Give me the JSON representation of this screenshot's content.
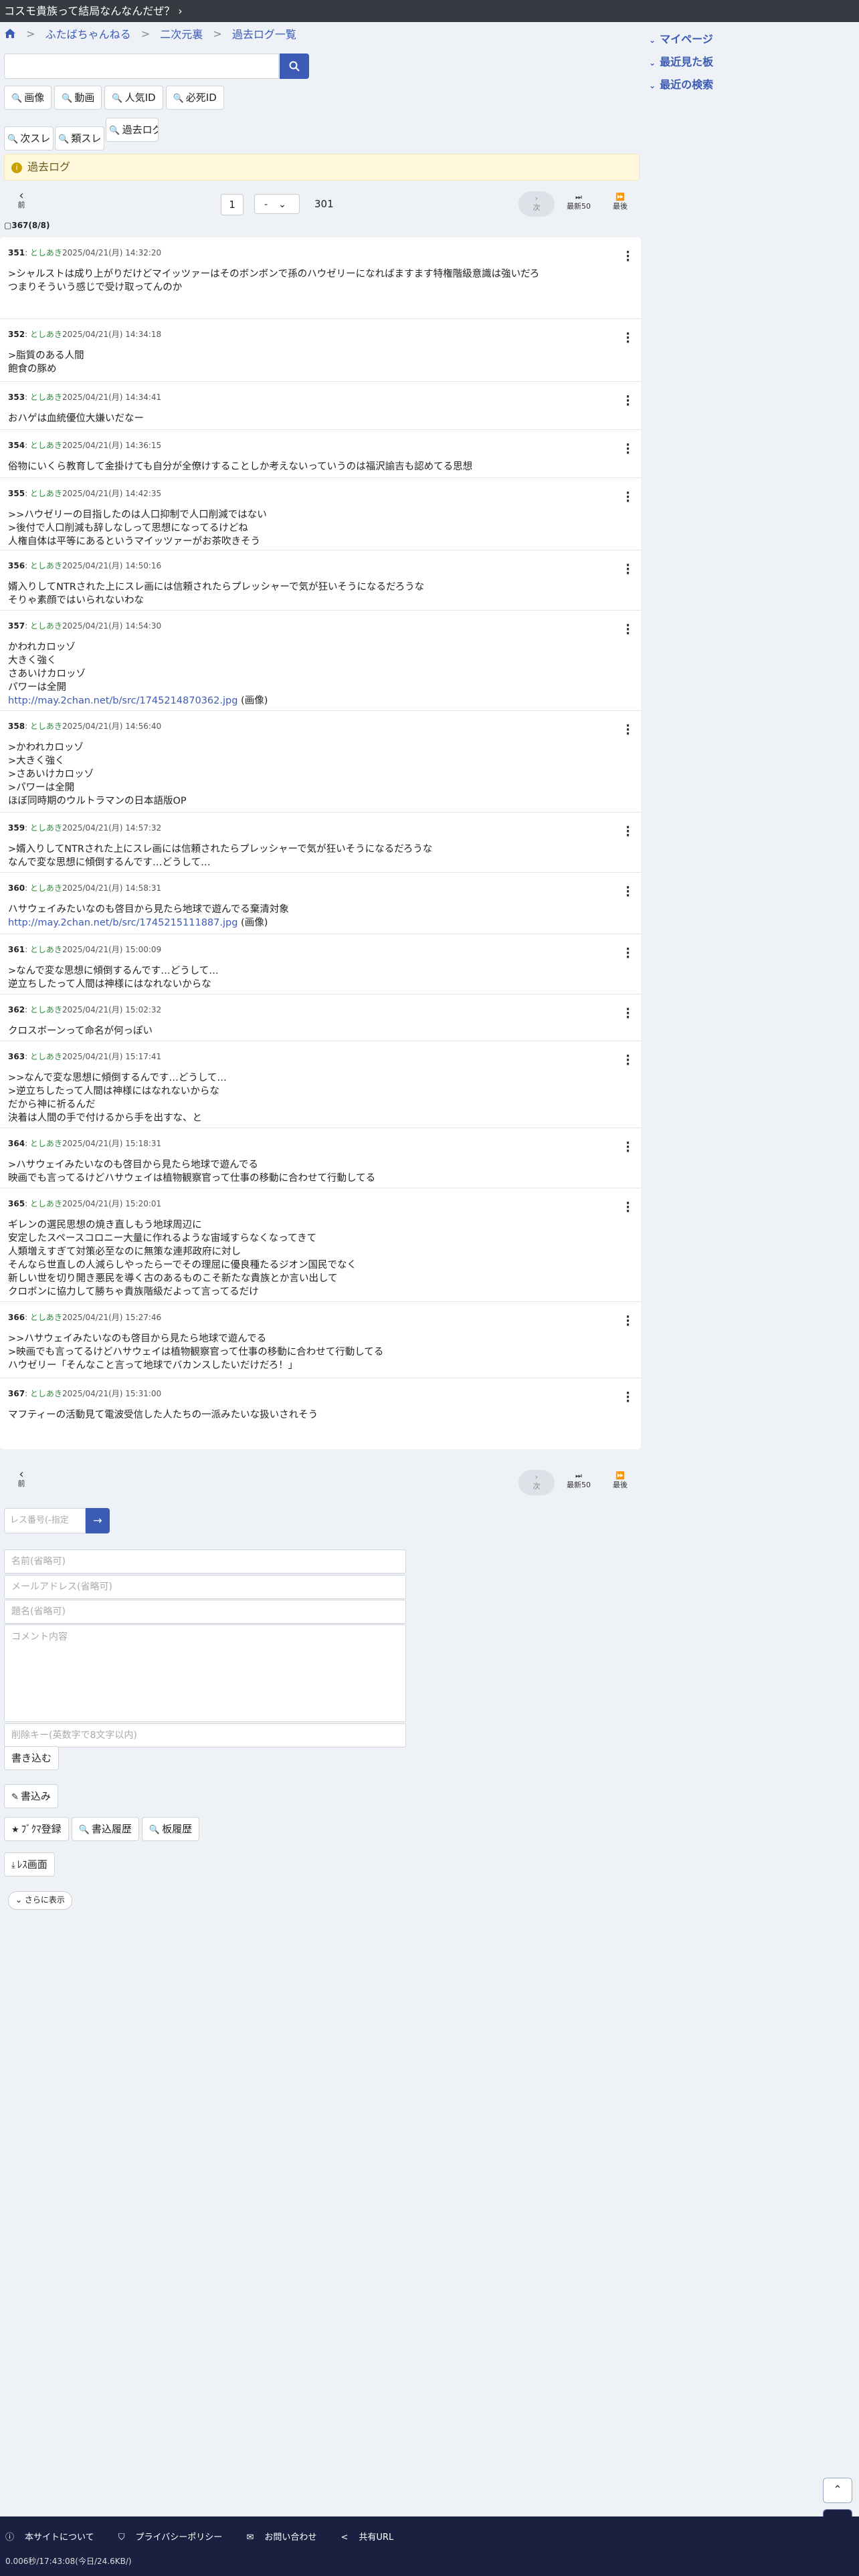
{
  "topbar": {
    "title": "コスモ貴族って結局なんなんだぜ？"
  },
  "breadcrumb": {
    "board": "ふたばちゃんねる",
    "category": "二次元裏",
    "page": "過去ログ一覧"
  },
  "rightnav": {
    "items": [
      "マイページ",
      "最近見た板",
      "最近の検索"
    ]
  },
  "search": {
    "placeholder": ""
  },
  "filters": {
    "row1": [
      "画像",
      "動画",
      "人気ID",
      "必死ID"
    ],
    "row2": [
      "次スレ",
      "類スレ",
      "過去ログ"
    ]
  },
  "notice": {
    "text": "過去ログ"
  },
  "pager": {
    "prev": "前",
    "page": "1",
    "select": "-",
    "total": "301",
    "next": "次",
    "latest": "最新50",
    "last": "最後"
  },
  "count": "367(8/8)",
  "posts": [
    {
      "no": "351",
      "name": "としあき",
      "date": "2025/04/21(月) 14:32:20",
      "body": ">シャルストは成り上がりだけどマイッツァーはそのボンボンで孫のハウゼリーになればますます特権階級意識は強いだろ\nつまりそういう感じで受け取ってんのか"
    },
    {
      "no": "352",
      "name": "としあき",
      "date": "2025/04/21(月) 14:34:18",
      "body": ">脂質のある人間\n飽食の豚め"
    },
    {
      "no": "353",
      "name": "としあき",
      "date": "2025/04/21(月) 14:34:41",
      "body": "おハゲは血統優位大嫌いだなー"
    },
    {
      "no": "354",
      "name": "としあき",
      "date": "2025/04/21(月) 14:36:15",
      "body": "俗物にいくら教育して金掛けても自分が全僚けすることしか考えないっていうのは福沢諭吉も認めてる思想"
    },
    {
      "no": "355",
      "name": "としあき",
      "date": "2025/04/21(月) 14:42:35",
      "body": ">>ハウゼリーの目指したのは人口抑制で人口削減ではない\n>後付で人口削減も辞しなしって思想になってるけどね\n人権自体は平等にあるというマイッツァーがお茶吹きそう"
    },
    {
      "no": "356",
      "name": "としあき",
      "date": "2025/04/21(月) 14:50:16",
      "body": "婿入りしてNTRされた上にスレ画には信頼されたらプレッシャーで気が狂いそうになるだろうな\nそりゃ素顔ではいられないわな"
    },
    {
      "no": "357",
      "name": "としあき",
      "date": "2025/04/21(月) 14:54:30",
      "body": "かわれカロッゾ\n大きく強く\nさあいけカロッゾ\nパワーは全開\n",
      "link": "http://may.2chan.net/b/src/1745214870362.jpg",
      "link_suffix": " (画像)"
    },
    {
      "no": "358",
      "name": "としあき",
      "date": "2025/04/21(月) 14:56:40",
      "body": ">かわれカロッゾ\n>大きく強く\n>さあいけカロッゾ\n>パワーは全開\nほぼ同時期のウルトラマンの日本語版OP"
    },
    {
      "no": "359",
      "name": "としあき",
      "date": "2025/04/21(月) 14:57:32",
      "body": ">婿入りしてNTRされた上にスレ画には信頼されたらプレッシャーで気が狂いそうになるだろうな\nなんで変な思想に傾倒するんです…どうして…"
    },
    {
      "no": "360",
      "name": "としあき",
      "date": "2025/04/21(月) 14:58:31",
      "body": "ハサウェイみたいなのも啓目から見たら地球で遊んでる棄清対象\n",
      "link": "http://may.2chan.net/b/src/1745215111887.jpg",
      "link_suffix": " (画像)"
    },
    {
      "no": "361",
      "name": "としあき",
      "date": "2025/04/21(月) 15:00:09",
      "body": ">なんで変な思想に傾倒するんです…どうして…\n逆立ちしたって人間は神様にはなれないからな"
    },
    {
      "no": "362",
      "name": "としあき",
      "date": "2025/04/21(月) 15:02:32",
      "body": "クロスボーンって命名が何っぽい"
    },
    {
      "no": "363",
      "name": "としあき",
      "date": "2025/04/21(月) 15:17:41",
      "body": ">>なんで変な思想に傾倒するんです…どうして…\n>逆立ちしたって人間は神様にはなれないからな\nだから神に祈るんだ\n決着は人間の手で付けるから手を出すな、と"
    },
    {
      "no": "364",
      "name": "としあき",
      "date": "2025/04/21(月) 15:18:31",
      "body": ">ハサウェイみたいなのも啓目から見たら地球で遊んでる\n映画でも言ってるけどハサウェイは植物観察官って仕事の移動に合わせて行動してる"
    },
    {
      "no": "365",
      "name": "としあき",
      "date": "2025/04/21(月) 15:20:01",
      "body": "ギレンの選民思想の焼き直しもう地球周辺に\n安定したスペースコロニー大量に作れるような宙域すらなくなってきて\n人類増えすぎて対策必至なのに無策な連邦政府に対し\nそんなら世直しの人減らしやったらーでその理屈に優良種たるジオン国民でなく\n新しい世を切り開き悪民を導く古のあるものこそ新たな貴族とか言い出して\nクロボンに協力して勝ちゃ貴族階級だよって言ってるだけ"
    },
    {
      "no": "366",
      "name": "としあき",
      "date": "2025/04/21(月) 15:27:46",
      "body": ">>ハサウェイみたいなのも啓目から見たら地球で遊んでる\n>映画でも言ってるけどハサウェイは植物観察官って仕事の移動に合わせて行動してる\nハウゼリー「そんなこと言って地球でバカンスしたいだけだろ！」"
    },
    {
      "no": "367",
      "name": "としあき",
      "date": "2025/04/21(月) 15:31:00",
      "body": "マフティーの活動見て電波受信した人たちの一派みたいな扱いされそう"
    }
  ],
  "resjump": {
    "placeholder": "レス番号(-指定",
    "go": "→"
  },
  "form": {
    "name_ph": "名前(省略可)",
    "mail_ph": "メールアドレス(省略可)",
    "subject_ph": "題名(省略可)",
    "comment_ph": "コメント内容",
    "delkey_ph": "削除キー(英数字で8文字以内)",
    "submit": "書き込む"
  },
  "actions": {
    "write": "書込み",
    "bookmark": "ﾌﾞｸﾏ登録",
    "history": "書込履歴",
    "board_history": "板履歴",
    "download": "ﾚｽ画面",
    "more": "さらに表示"
  },
  "footer": {
    "about": "本サイトについて",
    "privacy": "プライバシーポリシー",
    "contact": "お問い合わせ",
    "share": "共有URL",
    "stat": "0.006秒/17:43:08(今日/24.6KB/)"
  }
}
